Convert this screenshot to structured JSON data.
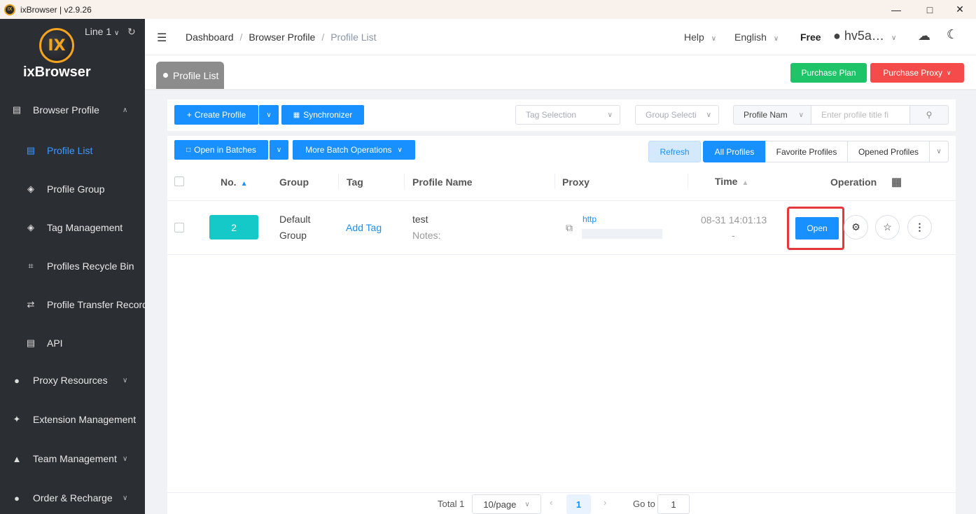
{
  "window": {
    "title": "ixBrowser | v2.9.26",
    "controls": {
      "minimize": "—",
      "maximize": "□",
      "close": "✕"
    }
  },
  "sidebar": {
    "brand": "ixBrowser",
    "logo_text": "IX",
    "line": "Line 1",
    "items": [
      {
        "label": "Browser Profile",
        "icon": "browser-icon",
        "glyph": "▤",
        "chevron": "∧"
      },
      {
        "label": "Profile List",
        "icon": "list-icon",
        "glyph": "▤",
        "active": true
      },
      {
        "label": "Profile Group",
        "icon": "layers-icon",
        "glyph": "◈"
      },
      {
        "label": "Tag Management",
        "icon": "tag-layers-icon",
        "glyph": "◈"
      },
      {
        "label": "Profiles Recycle Bin",
        "icon": "trash-icon",
        "glyph": "⌗"
      },
      {
        "label": "Profile Transfer Record",
        "icon": "transfer-icon",
        "glyph": "⇄"
      },
      {
        "label": "API",
        "icon": "api-icon",
        "glyph": "▤"
      },
      {
        "label": "Proxy Resources",
        "icon": "globe-icon",
        "glyph": "●",
        "chevron": "∨"
      },
      {
        "label": "Extension Management",
        "icon": "puzzle-icon",
        "glyph": "✦"
      },
      {
        "label": "Team Management",
        "icon": "team-icon",
        "glyph": "▲",
        "chevron": "∨"
      },
      {
        "label": "Order & Recharge",
        "icon": "coin-icon",
        "glyph": "●",
        "chevron": "∨"
      }
    ]
  },
  "header": {
    "breadcrumb": [
      "Dashboard",
      "Browser Profile",
      "Profile List"
    ],
    "help": "Help",
    "language": "English",
    "plan": "Free",
    "user": "hv5a…"
  },
  "tabs": {
    "active": "Profile List"
  },
  "actions": {
    "purchase_plan": "Purchase Plan",
    "purchase_proxy": "Purchase Proxy"
  },
  "toolbar": {
    "create_profile": "Create Profile",
    "synchronizer": "Synchronizer",
    "tag_selection": "Tag Selection",
    "group_selection": "Group Selecti",
    "search_field": "Profile Nam",
    "search_placeholder": "Enter profile title fi",
    "open_in_batches": "Open in Batches",
    "more_batch": "More Batch Operations",
    "refresh": "Refresh",
    "filters": [
      "All Profiles",
      "Favorite Profiles",
      "Opened Profiles"
    ]
  },
  "table": {
    "headers": {
      "no": "No.",
      "group": "Group",
      "tag": "Tag",
      "profile_name": "Profile Name",
      "proxy": "Proxy",
      "time": "Time",
      "operation": "Operation"
    },
    "rows": [
      {
        "no": "2",
        "group_line1": "Default",
        "group_line2": "Group",
        "tag": "Add Tag",
        "name": "test",
        "notes": "Notes:",
        "proxy_type": "http",
        "time": "08-31 14:01:13",
        "time2": "-",
        "open": "Open"
      }
    ]
  },
  "pagination": {
    "total": "Total 1",
    "page_size": "10/page",
    "current": "1",
    "goto_label": "Go to",
    "goto_value": "1"
  },
  "colors": {
    "primary": "#1890ff",
    "sidebar": "#2b2e33",
    "success": "#1ec467",
    "danger": "#f54b4b",
    "teal": "#16c9c9",
    "highlight": "#e5383b"
  }
}
